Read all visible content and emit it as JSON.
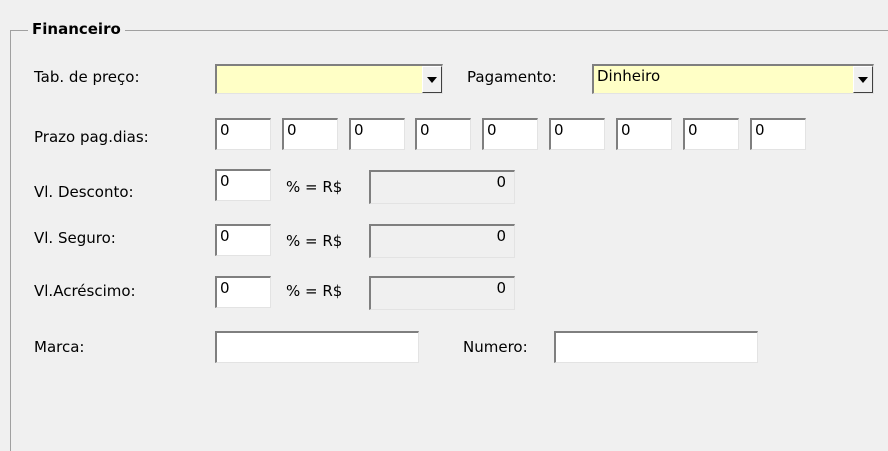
{
  "group": {
    "title": "Financeiro"
  },
  "tabela_preco": {
    "label": "Tab. de preço:",
    "value": ""
  },
  "pagamento": {
    "label": "Pagamento:",
    "value": "Dinheiro"
  },
  "prazo": {
    "label": "Prazo pag.dias:",
    "values": [
      "0",
      "0",
      "0",
      "0",
      "0",
      "0",
      "0",
      "0",
      "0"
    ]
  },
  "desconto": {
    "label": "Vl. Desconto:",
    "percent": "0",
    "eq": "% = R$",
    "amount": "0"
  },
  "seguro": {
    "label": "Vl. Seguro:",
    "percent": "0",
    "eq": "% = R$",
    "amount": "0"
  },
  "acrescimo": {
    "label": "Vl.Acréscimo:",
    "percent": "0",
    "eq": "% = R$",
    "amount": "0"
  },
  "marca": {
    "label": "Marca:",
    "value": ""
  },
  "numero": {
    "label": "Numero:",
    "value": ""
  },
  "icons": {
    "dropdown": "chevron-down-icon"
  }
}
